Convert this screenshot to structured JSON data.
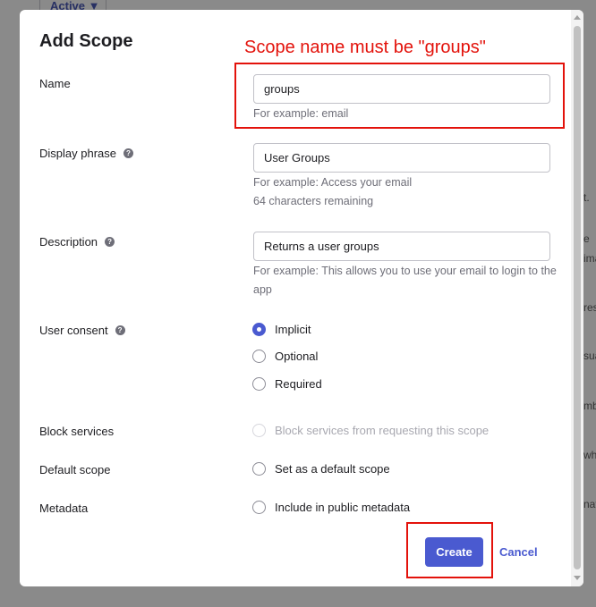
{
  "background": {
    "active_button": "Active ▼",
    "fragments": [
      "t.",
      "e",
      "ima",
      "res",
      "sua",
      "mb",
      "wh",
      "nat"
    ]
  },
  "modal": {
    "title": "Add Scope",
    "annotation": "Scope name must be \"groups\"",
    "annotation_color": "#e3120b",
    "accent_color": "#4a5ad0",
    "name": {
      "label": "Name",
      "value": "groups",
      "hint": "For example: email"
    },
    "display_phrase": {
      "label": "Display phrase",
      "help_icon": "question-circle-icon",
      "value": "User Groups",
      "hint": "For example: Access your email",
      "remaining": "64 characters remaining"
    },
    "description": {
      "label": "Description",
      "help_icon": "question-circle-icon",
      "value": "Returns a user groups",
      "hint": "For example: This allows you to use your email to login to the app"
    },
    "user_consent": {
      "label": "User consent",
      "help_icon": "question-circle-icon",
      "options": [
        "Implicit",
        "Optional",
        "Required"
      ],
      "selected": "Implicit"
    },
    "block_services": {
      "label": "Block services",
      "option": "Block services from requesting this scope",
      "disabled": true
    },
    "default_scope": {
      "label": "Default scope",
      "option": "Set as a default scope"
    },
    "metadata": {
      "label": "Metadata",
      "option": "Include in public metadata"
    },
    "create_label": "Create",
    "cancel_label": "Cancel"
  }
}
